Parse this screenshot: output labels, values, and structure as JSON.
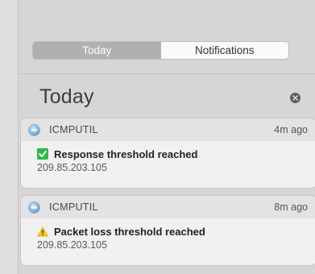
{
  "tabs": [
    {
      "label": "Today",
      "active": true
    },
    {
      "label": "Notifications",
      "active": false
    }
  ],
  "section": {
    "title": "Today",
    "clear_icon": "close-circle-icon"
  },
  "notifications": [
    {
      "app": "ICMPUTIL",
      "time": "4m ago",
      "status_icon": "green-check-icon",
      "title": "Response threshold reached",
      "subtitle": "209.85.203.105"
    },
    {
      "app": "ICMPUTIL",
      "time": "8m ago",
      "status_icon": "warning-triangle-icon",
      "title": "Packet loss threshold reached",
      "subtitle": "209.85.203.105"
    }
  ],
  "colors": {
    "active_tab": "#b0b0b0",
    "check_green": "#2eb84a",
    "warning_yellow": "#f5c518"
  }
}
